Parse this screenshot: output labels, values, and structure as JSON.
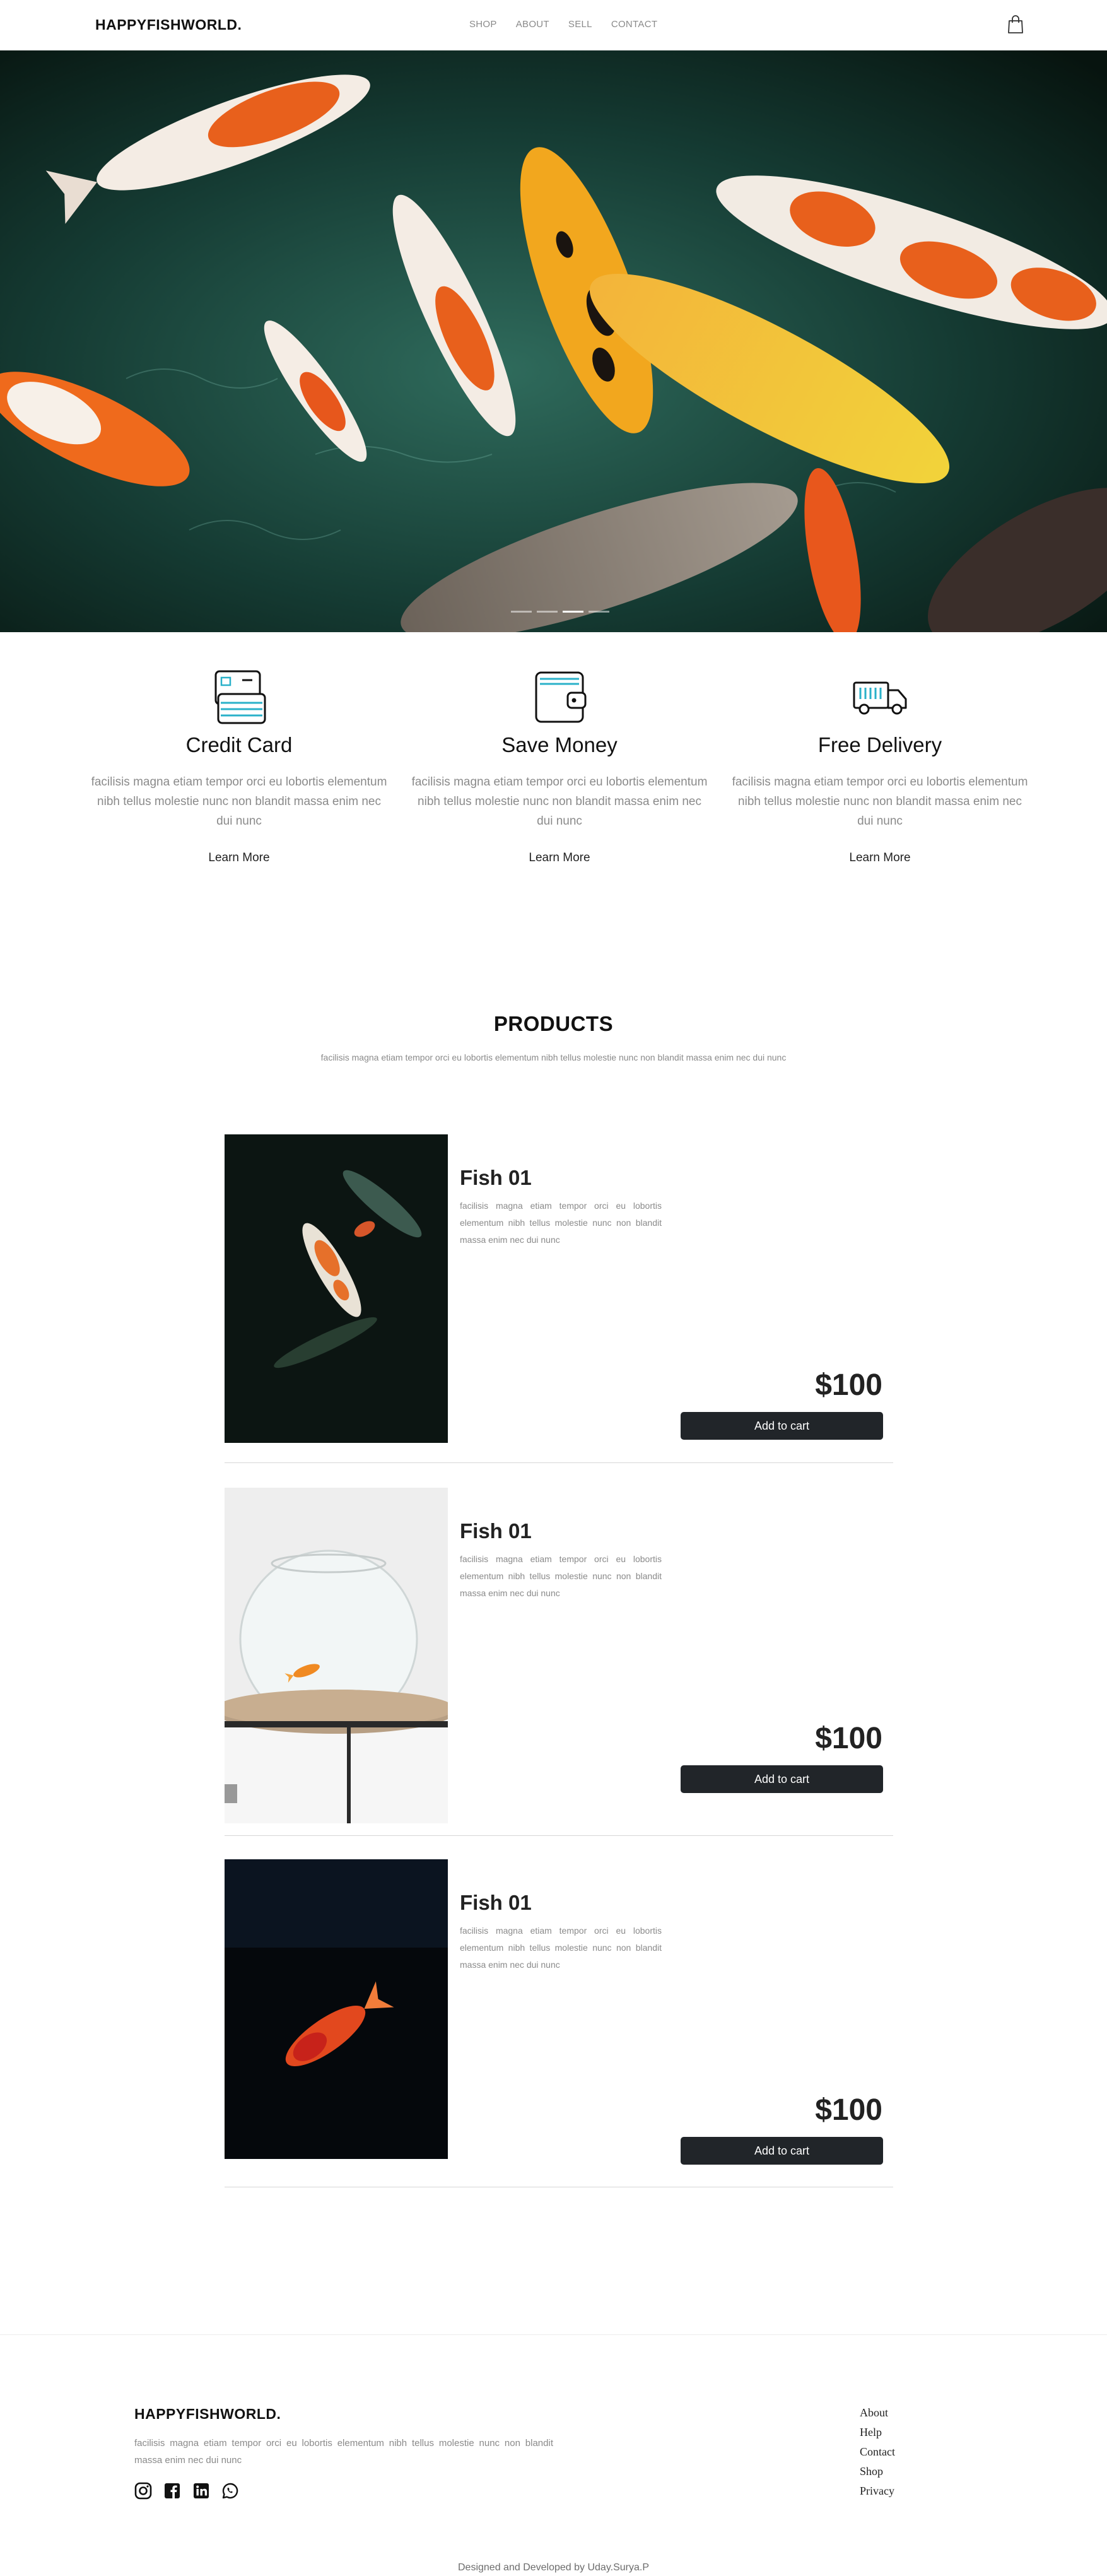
{
  "navbar": {
    "brand": "HAPPYFISHWORLD.",
    "links": [
      "SHOP",
      "ABOUT",
      "SELL",
      "CONTACT"
    ],
    "cart_icon": "shopping-bag-icon"
  },
  "hero": {
    "slide_count": 4,
    "active_slide": 3
  },
  "features": [
    {
      "icon": "credit-card-icon",
      "title": "Credit Card",
      "text": "facilisis magna etiam tempor orci eu lobortis elementum nibh tellus molestie nunc non blandit massa enim nec dui nunc",
      "link": "Learn More"
    },
    {
      "icon": "wallet-icon",
      "title": "Save Money",
      "text": "facilisis magna etiam tempor orci eu lobortis elementum nibh tellus molestie nunc non blandit massa enim nec dui nunc",
      "link": "Learn More"
    },
    {
      "icon": "delivery-truck-icon",
      "title": "Free Delivery",
      "text": "facilisis magna etiam tempor orci eu lobortis elementum nibh tellus molestie nunc non blandit massa enim nec dui nunc",
      "link": "Learn More"
    }
  ],
  "products_section": {
    "title": "PRODUCTS",
    "subtitle": "facilisis magna etiam tempor orci eu lobortis elementum nibh tellus molestie nunc non blandit massa enim nec dui nunc",
    "items": [
      {
        "name": "Fish 01",
        "description": "facilisis magna etiam tempor orci eu lobortis elementum nibh tellus molestie nunc non blandit massa enim nec dui nunc",
        "price": "$100",
        "button": "Add to cart"
      },
      {
        "name": "Fish 01",
        "description": "facilisis magna etiam tempor orci eu lobortis elementum nibh tellus molestie nunc non blandit massa enim nec dui nunc",
        "price": "$100",
        "button": "Add to cart"
      },
      {
        "name": "Fish 01",
        "description": "facilisis magna etiam tempor orci eu lobortis elementum nibh tellus molestie nunc non blandit massa enim nec dui nunc",
        "price": "$100",
        "button": "Add to cart"
      }
    ]
  },
  "footer": {
    "brand": "HAPPYFISHWORLD.",
    "description": "facilisis magna etiam tempor orci eu lobortis elementum nibh tellus molestie nunc non blandit massa enim nec dui nunc",
    "social_icons": [
      "instagram-icon",
      "facebook-icon",
      "linkedin-icon",
      "whatsapp-icon"
    ],
    "links": [
      "About",
      "Help",
      "Contact",
      "Shop",
      "Privacy"
    ],
    "credit": "Designed and Developed by Uday.Surya.P"
  }
}
